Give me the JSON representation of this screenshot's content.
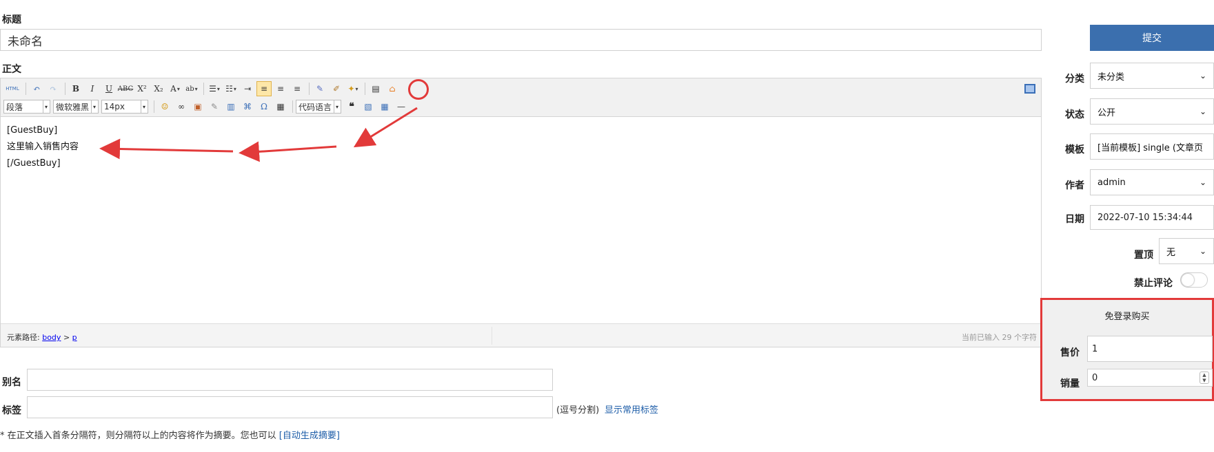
{
  "title_field": {
    "label": "标题",
    "value": "未命名"
  },
  "body_field": {
    "label": "正文"
  },
  "editor": {
    "font_block": "段落",
    "font_family": "微软雅黑",
    "font_size": "14px",
    "code_language": "代码语言",
    "content_lines": [
      "[GuestBuy]",
      "这里输入销售内容",
      "[/GuestBuy]"
    ],
    "status_path_prefix": "元素路径:",
    "status_path_body": "body",
    "status_path_sep": ">",
    "status_path_p": "p",
    "char_count": "当前已输入 29 个字符",
    "html_label": "HTML"
  },
  "alias_field": {
    "label": "别名",
    "value": ""
  },
  "tags_field": {
    "label": "标签",
    "value": "",
    "hint": "(逗号分割)",
    "link": "显示常用标签"
  },
  "summary_note": {
    "text": "* 在正文插入首条分隔符，则分隔符以上的内容将作为摘要。您也可以",
    "link": "[自动生成摘要]"
  },
  "sidebar": {
    "submit": "提交",
    "category": {
      "label": "分类",
      "value": "未分类"
    },
    "status": {
      "label": "状态",
      "value": "公开"
    },
    "template": {
      "label": "模板",
      "value": "[当前模板] single (文章页"
    },
    "author": {
      "label": "作者",
      "value": "admin"
    },
    "date": {
      "label": "日期",
      "value": "2022-07-10 15:34:44"
    },
    "pin": {
      "label": "置顶",
      "value": "无"
    },
    "no_comment": {
      "label": "禁止评论",
      "enabled": false
    }
  },
  "guestbuy": {
    "title": "免登录购买",
    "price_label": "售价",
    "price_value": "1",
    "sales_label": "销量",
    "sales_value": "0"
  },
  "colors": {
    "accent": "#3b6fae",
    "highlight": "#e23a3a",
    "link": "#1d5da8"
  }
}
